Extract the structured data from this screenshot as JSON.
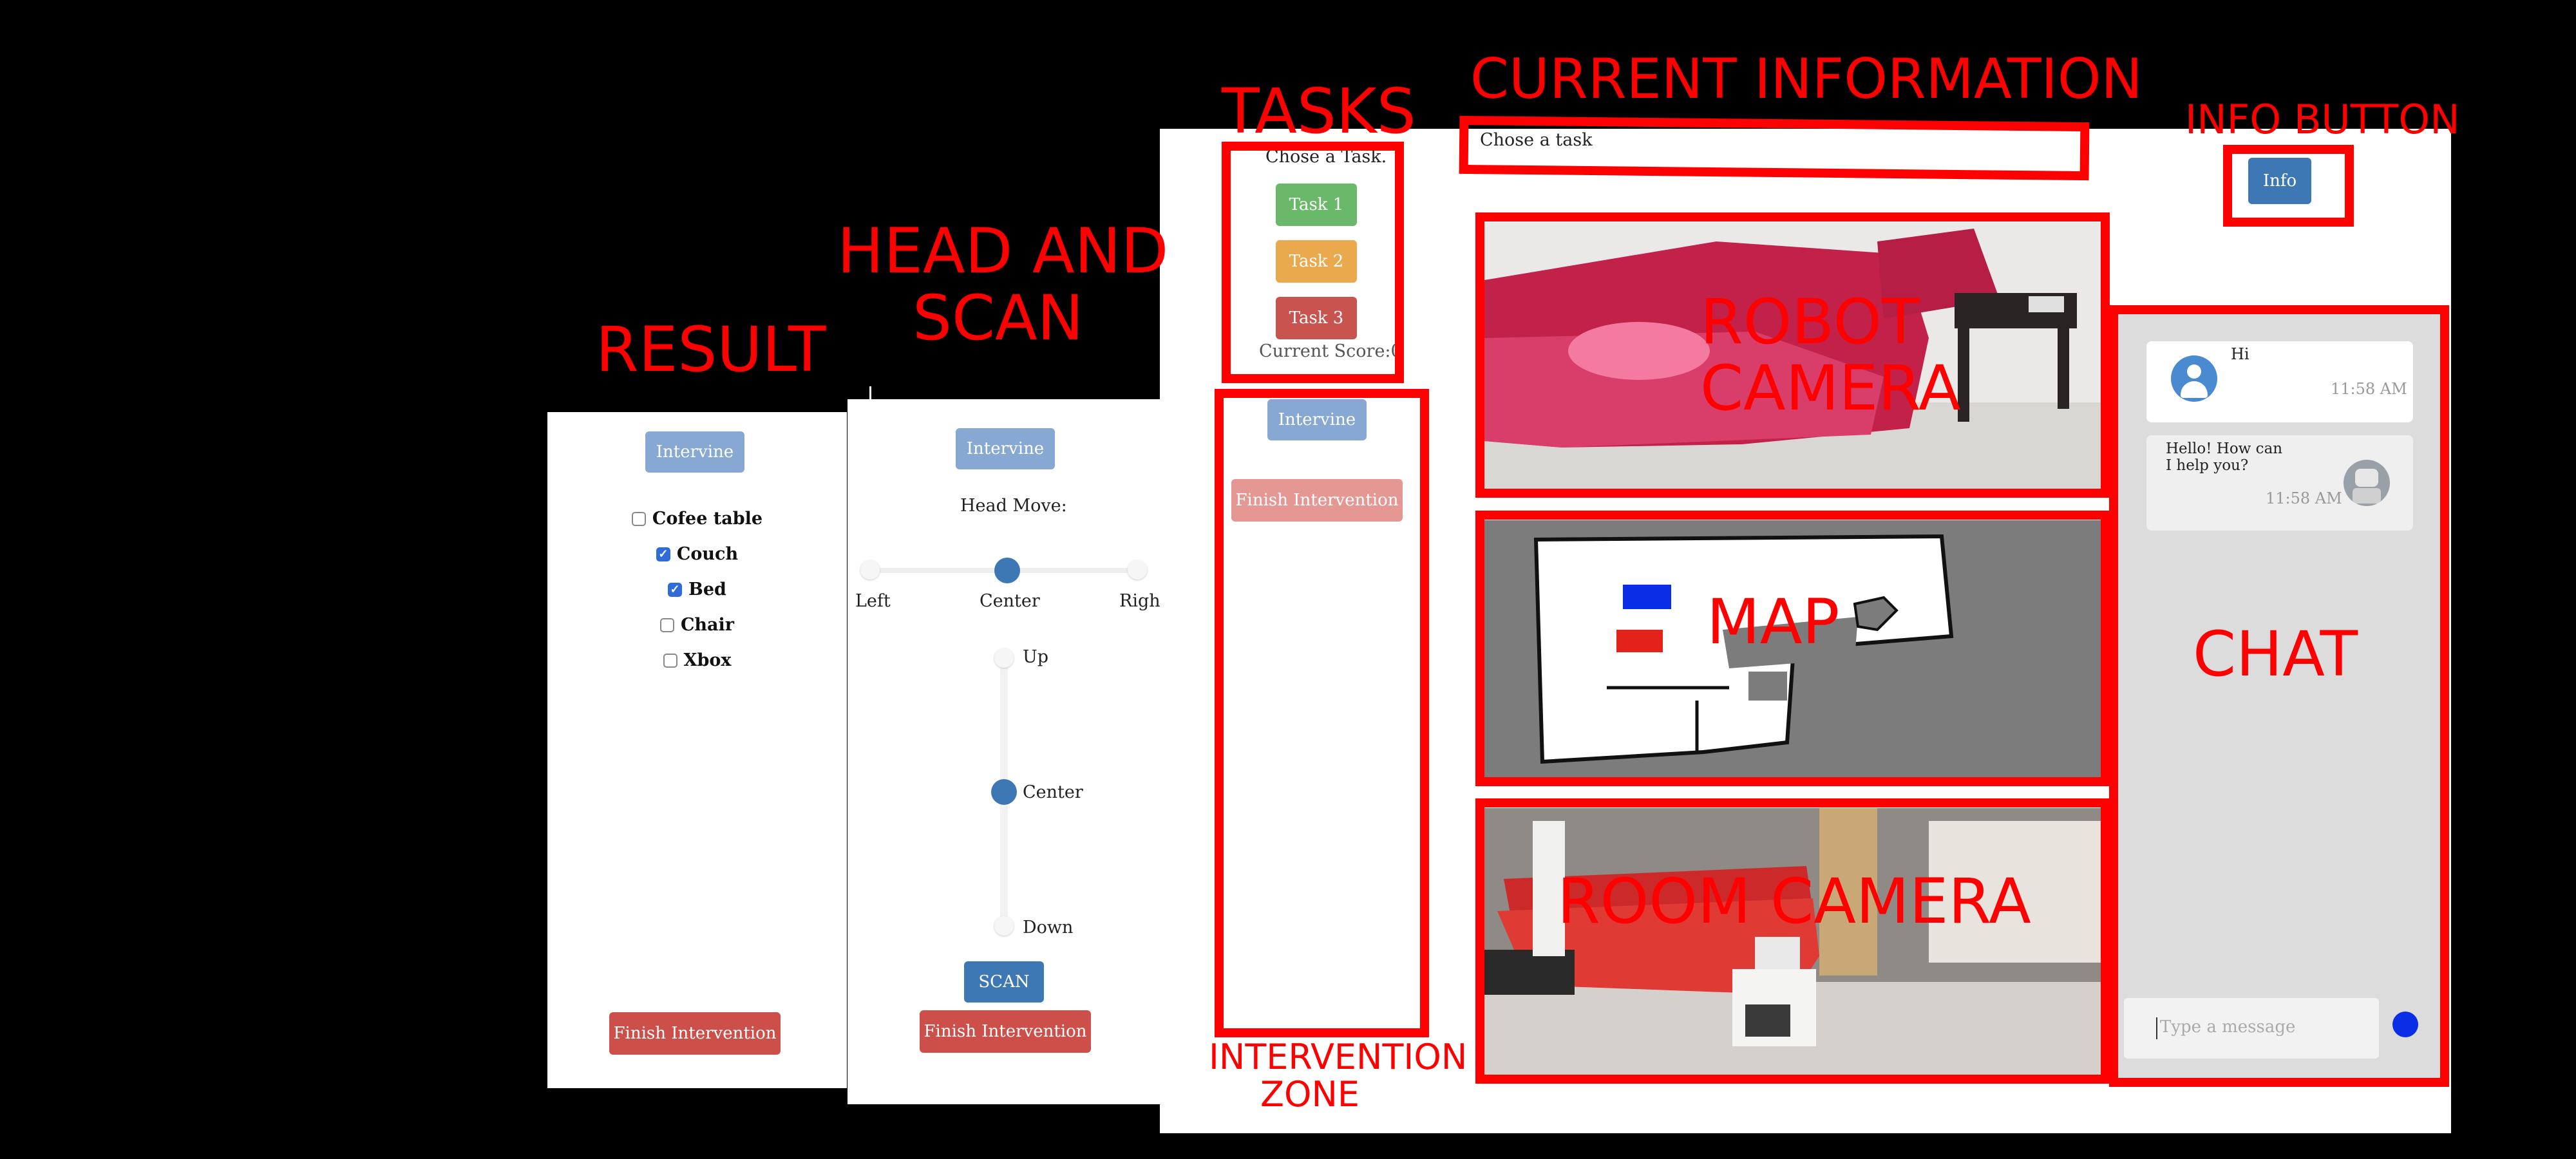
{
  "labels": {
    "tasks": "TASKS",
    "current_information": "CURRENT INFORMATION",
    "info_button": "INFO BUTTON",
    "head_and_scan": [
      "HEAD AND",
      "SCAN"
    ],
    "result": "RESULT",
    "robot_camera": [
      "ROBOT",
      "CAMERA"
    ],
    "map": "MAP",
    "chat": "CHAT",
    "room_camera": "ROOM CAMERA",
    "intervention_zone": [
      "INTERVENTION",
      "ZONE"
    ]
  },
  "result_panel": {
    "intervine_label": "Intervine",
    "objects": [
      {
        "label": "Cofee table",
        "checked": false
      },
      {
        "label": "Couch",
        "checked": true
      },
      {
        "label": "Bed",
        "checked": true
      },
      {
        "label": "Chair",
        "checked": false
      },
      {
        "label": "Xbox",
        "checked": false
      }
    ],
    "finish_label": "Finish Intervention"
  },
  "head_panel": {
    "intervine_label": "Intervine",
    "head_move_label": "Head Move:",
    "horizontal": {
      "left": "Left",
      "center": "Center",
      "right": "Right",
      "value": 0.5
    },
    "vertical": {
      "up": "Up",
      "center": "Center",
      "down": "Down",
      "value": 0.5
    },
    "scan_label": "SCAN",
    "finish_label": "Finish Intervention"
  },
  "tasks": {
    "prompt": "Chose a Task.",
    "buttons": [
      "Task 1",
      "Task 2",
      "Task 3"
    ],
    "score": "Current Score:0"
  },
  "intervention": {
    "intervine_label": "Intervine",
    "finish_label": "Finish Intervention"
  },
  "info_bar": {
    "text": "Chose a task"
  },
  "info_button": {
    "label": "Info"
  },
  "chat": {
    "messages": [
      {
        "text": "Hi",
        "time": "11:58 AM",
        "from": "user"
      },
      {
        "text": "Hello! How can I help you?",
        "time": "11:58 AM",
        "from": "robot"
      }
    ],
    "placeholder": "Type a message"
  },
  "colors": {
    "label_red": "#ff0000",
    "task1": "#6ab86a",
    "task2": "#e9a94c",
    "task3": "#c9534f",
    "primary": "#3d78b4",
    "primary_light": "#86a8d2",
    "danger": "#cc4f4a",
    "danger_light": "#e59794",
    "chat_bg": "#dcdcdc"
  }
}
